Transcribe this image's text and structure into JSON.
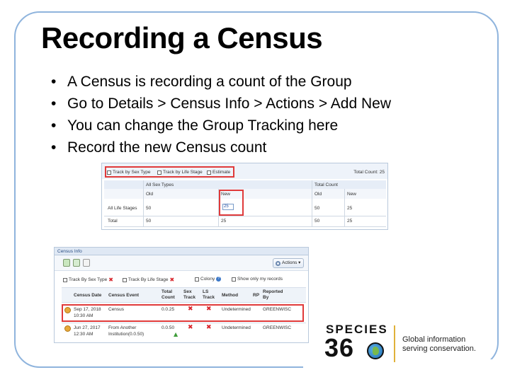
{
  "slide": {
    "title": "Recording a Census",
    "bullets": [
      "A Census is recording a count of the Group",
      "Go to Details > Census Info > Actions > Add New",
      "You can change the Group Tracking here",
      "Record the new Census count"
    ],
    "frame_color": "#8fb4dd",
    "highlight_color": "#e03a3a"
  },
  "grid": {
    "options": [
      "Track by Sex Type",
      "Track by Life Stage",
      "Estimate"
    ],
    "total_count": "Total Count: 25",
    "group_headers": [
      "All Sex Types",
      "Total Count"
    ],
    "sub_headers": [
      "Old",
      "New",
      "Old",
      "New"
    ],
    "rows": [
      {
        "label": "All Life Stages",
        "old": "50",
        "new": "25",
        "total_old": "50",
        "total_new": "25"
      },
      {
        "label": "Total",
        "old": "50",
        "new": "25",
        "total_old": "50",
        "total_new": "25"
      }
    ]
  },
  "census_info": {
    "title": "Census Info",
    "actions_label": "Actions",
    "options": [
      "Track By Sex Type",
      "Track By Life Stage",
      "Colony",
      "Show only my records"
    ],
    "columns": [
      "Census Date",
      "Census Event",
      "Total Count",
      "Sex Track",
      "LS Track",
      "Method",
      "RP",
      "Reported By"
    ],
    "rows": [
      {
        "date": "Sep 17, 2018",
        "time": "10:30 AM",
        "event": "Census",
        "event2": "",
        "count": "0.0.25",
        "method": "Undetermined",
        "reported_by": "GREENWISC"
      },
      {
        "date": "Jun 27, 2017",
        "time": "12:30 AM",
        "event": "From Another",
        "event2": "Institution(0.0.50)",
        "count": "0.0.50",
        "method": "Undetermined",
        "reported_by": "GREENWISC"
      }
    ]
  },
  "logo": {
    "word": "SPECIES",
    "number_a": "3",
    "number_b": "6",
    "tagline": [
      "Global information",
      "serving conservation."
    ],
    "accent": "#e0b13a"
  }
}
